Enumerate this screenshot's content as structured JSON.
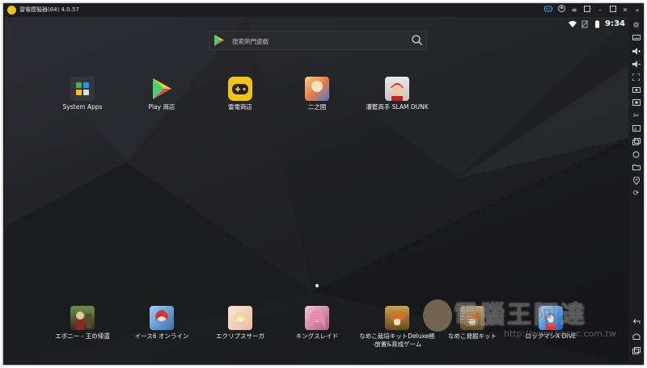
{
  "window": {
    "title": "雷電模擬器(64) 4.0.57",
    "titlebar_buttons": [
      "gamepad-icon",
      "account-icon",
      "menu-icon",
      "restore-icon",
      "minimize-icon",
      "maximize-icon",
      "close-icon",
      "collapse-icon"
    ]
  },
  "status_bar": {
    "time": "9:34",
    "icons": [
      "wifi-icon",
      "no-sim-icon",
      "battery-icon"
    ]
  },
  "search": {
    "placeholder": "搜索熱門遊戲"
  },
  "desktop_apps": [
    {
      "label": "System Apps",
      "icon": "system-apps-folder-icon"
    },
    {
      "label": "Play 商店",
      "icon": "play-store-icon"
    },
    {
      "label": "雷電商店",
      "icon": "ldstore-gamepad-icon"
    },
    {
      "label": "二之國",
      "icon": "ni-no-kuni-icon"
    },
    {
      "label": "灌籃高手 SLAM DUNK",
      "icon": "slam-dunk-icon"
    }
  ],
  "dock_apps": [
    {
      "label": "エボニー - 王の帰還",
      "icon": "ebony-icon"
    },
    {
      "label": "イース6 オンライン",
      "icon": "ys6-online-icon"
    },
    {
      "label": "エクリプスサーガ",
      "icon": "eclipse-saga-icon"
    },
    {
      "label": "キングスレイド",
      "icon": "kings-raid-icon"
    },
    {
      "label": "なめこ栽培キットDeluxe極 -放置&育成ゲーム",
      "icon": "nameko-deluxe-icon"
    },
    {
      "label": "なめこ発掘キット",
      "icon": "nameko-dig-icon"
    },
    {
      "label": "ロックマンX DiVE",
      "icon": "rockman-x-dive-icon"
    }
  ],
  "sidebar": {
    "buttons": [
      "settings-icon",
      "keyboard-icon",
      "volume-up-icon",
      "volume-down-icon",
      "fullscreen-icon",
      "screenshot-icon",
      "record-icon",
      "scissors-icon",
      "apk-install-icon",
      "multi-instance-icon",
      "shake-icon",
      "folder-icon",
      "location-icon",
      "rotate-icon"
    ],
    "nav_buttons": [
      "back-icon",
      "home-icon",
      "recent-apps-icon"
    ]
  },
  "watermark": {
    "text": "電腦王阿達",
    "url": "http://www.kocpc.com.tw"
  },
  "colors": {
    "accent_yellow": "#f3c21a",
    "background": "#1e1f22",
    "text": "#f2f2f2"
  }
}
